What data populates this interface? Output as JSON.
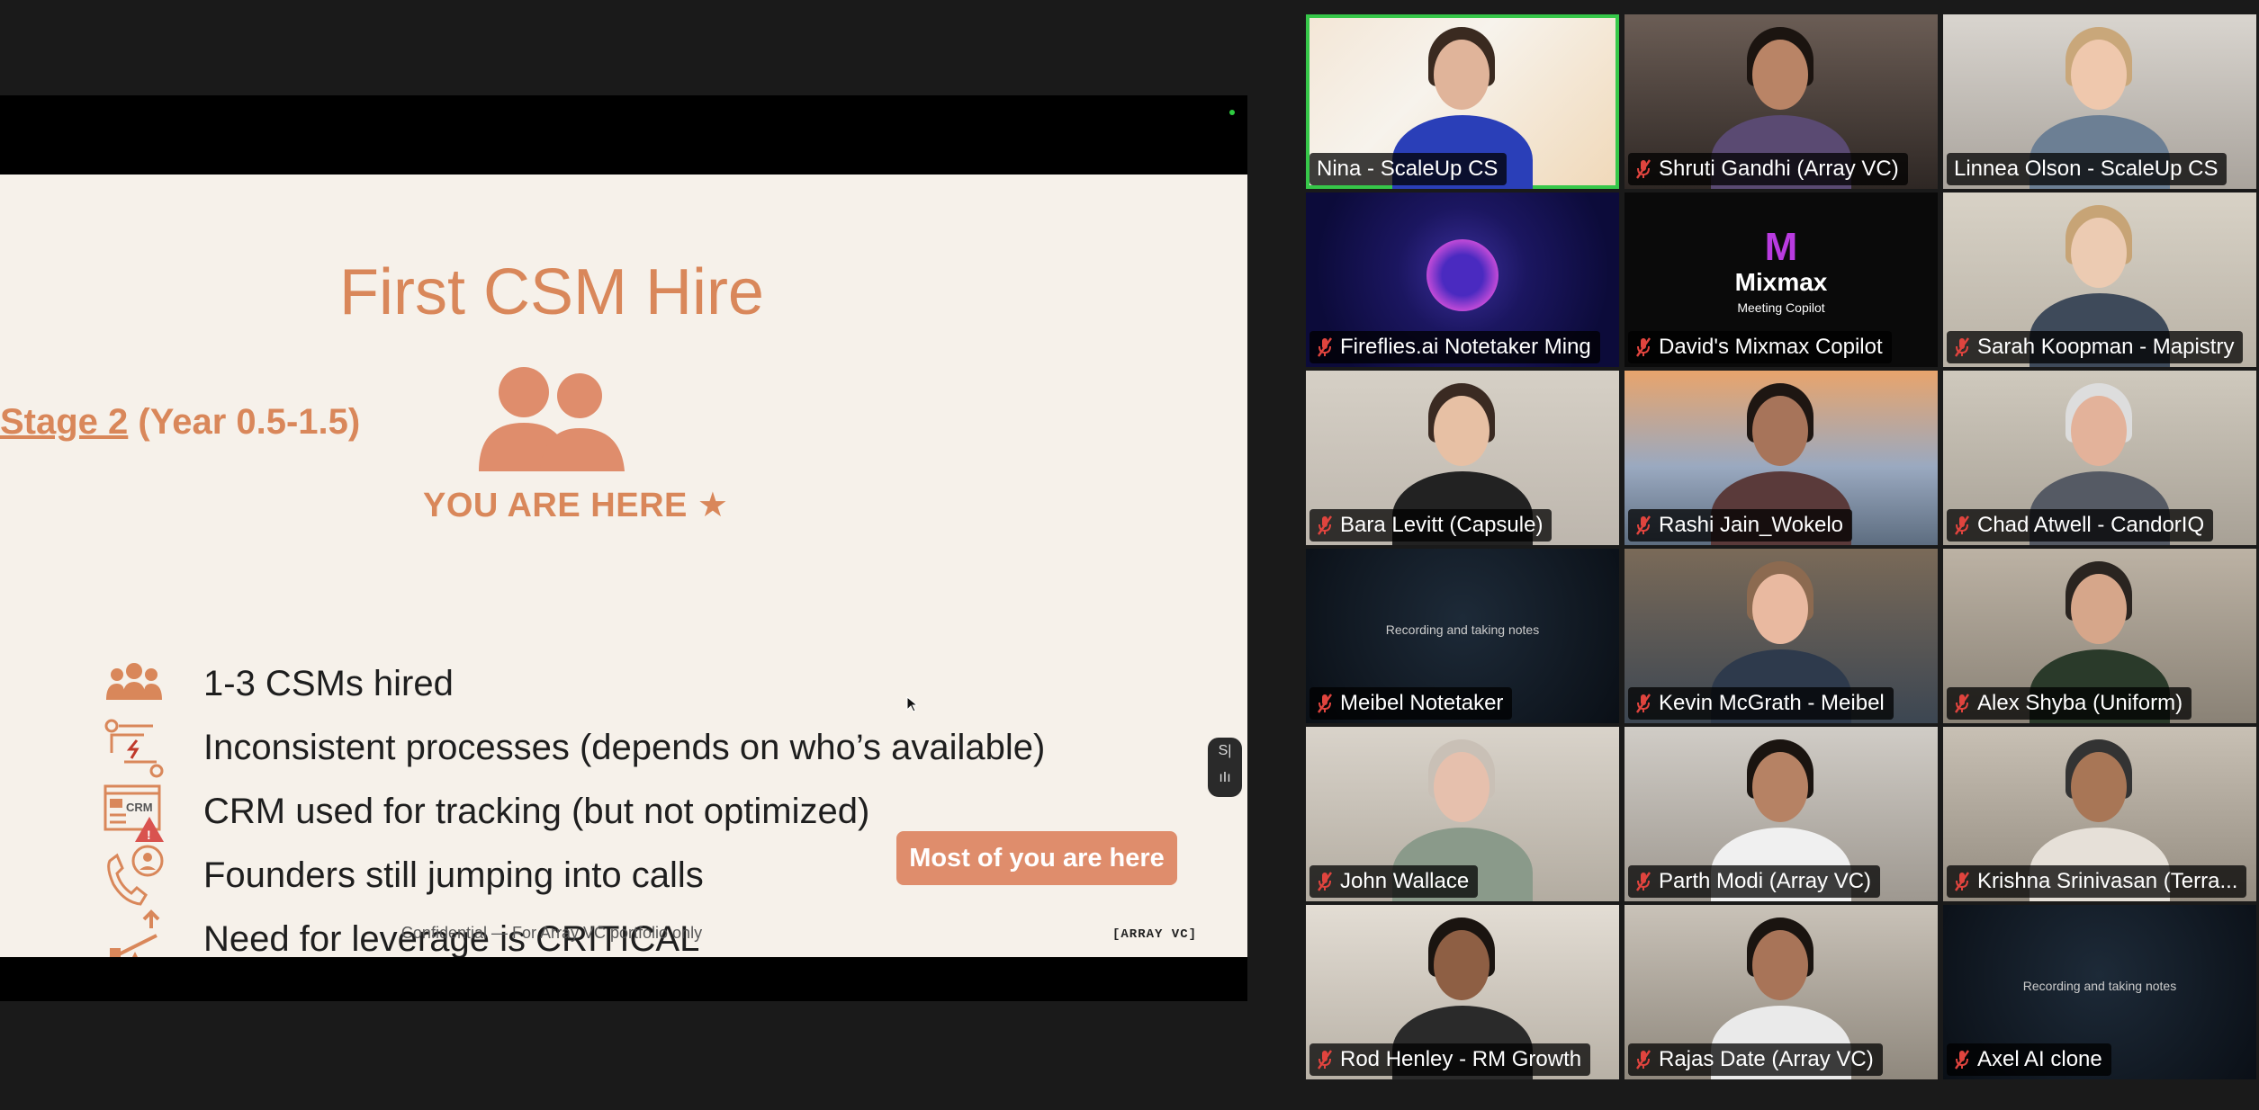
{
  "slide": {
    "title": "First CSM Hire",
    "stage_underlined": "Stage 2",
    "stage_rest": " (Year 0.5-1.5)",
    "here_label": "YOU ARE HERE ★",
    "bullets": [
      {
        "icon": "team-icon",
        "text": "1-3 CSMs hired"
      },
      {
        "icon": "process-arrows-icon",
        "text": "Inconsistent processes (depends on who’s available)"
      },
      {
        "icon": "crm-warning-icon",
        "text": "CRM used for tracking (but not optimized)"
      },
      {
        "icon": "phone-person-icon",
        "text": "Founders still jumping into calls"
      },
      {
        "icon": "lever-icon",
        "text": "Need for leverage is CRITICAL"
      }
    ],
    "badge": "Most of you are here",
    "confidential": "Confidential — For Array VC portfolio only",
    "brand": "[ARRAY VC]",
    "accent_color": "#d9875a"
  },
  "widget": {
    "label": "S|"
  },
  "participants": [
    {
      "name": "Nina - ScaleUp CS",
      "muted": false,
      "active": true
    },
    {
      "name": "Shruti Gandhi (Array VC)",
      "muted": true
    },
    {
      "name": "Linnea Olson - ScaleUp CS",
      "muted": false
    },
    {
      "name": "Fireflies.ai Notetaker Ming",
      "muted": true
    },
    {
      "name": "David's Mixmax Copilot",
      "muted": true,
      "logo": "Mixmax",
      "logo_sub": "Meeting Copilot"
    },
    {
      "name": "Sarah Koopman - Mapistry",
      "muted": true
    },
    {
      "name": "Bara Levitt (Capsule)",
      "muted": true
    },
    {
      "name": "Rashi Jain_Wokelo",
      "muted": true
    },
    {
      "name": "Chad Atwell - CandorIQ",
      "muted": true
    },
    {
      "name": "Meibel Notetaker",
      "muted": true,
      "center_text": "Recording and taking notes"
    },
    {
      "name": "Kevin McGrath - Meibel",
      "muted": true
    },
    {
      "name": "Alex Shyba (Uniform)",
      "muted": true
    },
    {
      "name": "John Wallace",
      "muted": true
    },
    {
      "name": "Parth Modi (Array VC)",
      "muted": true
    },
    {
      "name": "Krishna Srinivasan (Terra...",
      "muted": true
    },
    {
      "name": "Rod Henley - RM Growth",
      "muted": true
    },
    {
      "name": "Rajas Date (Array VC)",
      "muted": true
    },
    {
      "name": "Axel AI clone",
      "muted": true,
      "center_text": "Recording and taking notes"
    }
  ],
  "colors": {
    "active_border": "#36c749",
    "mute_red": "#e0443e"
  }
}
